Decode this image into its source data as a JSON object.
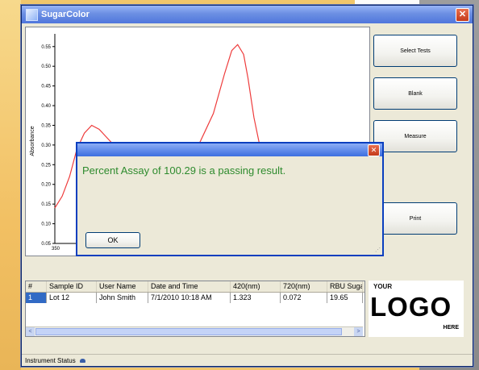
{
  "window": {
    "title": "SugarColor",
    "close_glyph": "✕"
  },
  "chart_data": {
    "type": "line",
    "xlabel": "",
    "ylabel": "Absorbance",
    "ylim": [
      0.05,
      0.57
    ],
    "y_ticks": [
      "0.55",
      "0.50",
      "0.45",
      "0.40",
      "0.35",
      "0.30",
      "0.25",
      "0.20",
      "0.15",
      "0.10",
      "0.05"
    ],
    "x_ticks": [
      "350"
    ],
    "line_color": "#ee3b3b",
    "series": [
      {
        "values": [
          [
            0,
            0.14
          ],
          [
            10,
            0.17
          ],
          [
            20,
            0.22
          ],
          [
            30,
            0.29
          ],
          [
            40,
            0.33
          ],
          [
            50,
            0.35
          ],
          [
            60,
            0.34
          ],
          [
            70,
            0.32
          ],
          [
            80,
            0.3
          ],
          [
            90,
            0.28
          ],
          [
            100,
            0.27
          ],
          [
            170,
            0.27
          ],
          [
            195,
            0.3
          ],
          [
            215,
            0.38
          ],
          [
            230,
            0.48
          ],
          [
            240,
            0.54
          ],
          [
            248,
            0.555
          ],
          [
            256,
            0.53
          ],
          [
            262,
            0.47
          ],
          [
            270,
            0.37
          ],
          [
            280,
            0.28
          ],
          [
            290,
            0.22
          ]
        ]
      }
    ]
  },
  "buttons": {
    "select_tests": "Select Tests",
    "blank": "Blank",
    "measure": "Measure",
    "print": "Print"
  },
  "table": {
    "headers": [
      "#",
      "Sample ID",
      "User Name",
      "Date and Time",
      "420(nm)",
      "720(nm)",
      "RBU Suga"
    ],
    "rows": [
      [
        "1",
        "Lot 12",
        "John Smith",
        "7/1/2010 10:18 AM",
        "1.323",
        "0.072",
        "19.65"
      ]
    ],
    "scroll_left": "<",
    "scroll_right": ">"
  },
  "logo": {
    "your": "YOUR",
    "main": "LOGO",
    "here": "HERE"
  },
  "status": {
    "label": "Instrument Status"
  },
  "dialog": {
    "message": "Percent Assay of 100.29 is a passing result.",
    "ok_label": "OK",
    "close_glyph": "✕",
    "message_color": "#2e8b2e"
  }
}
